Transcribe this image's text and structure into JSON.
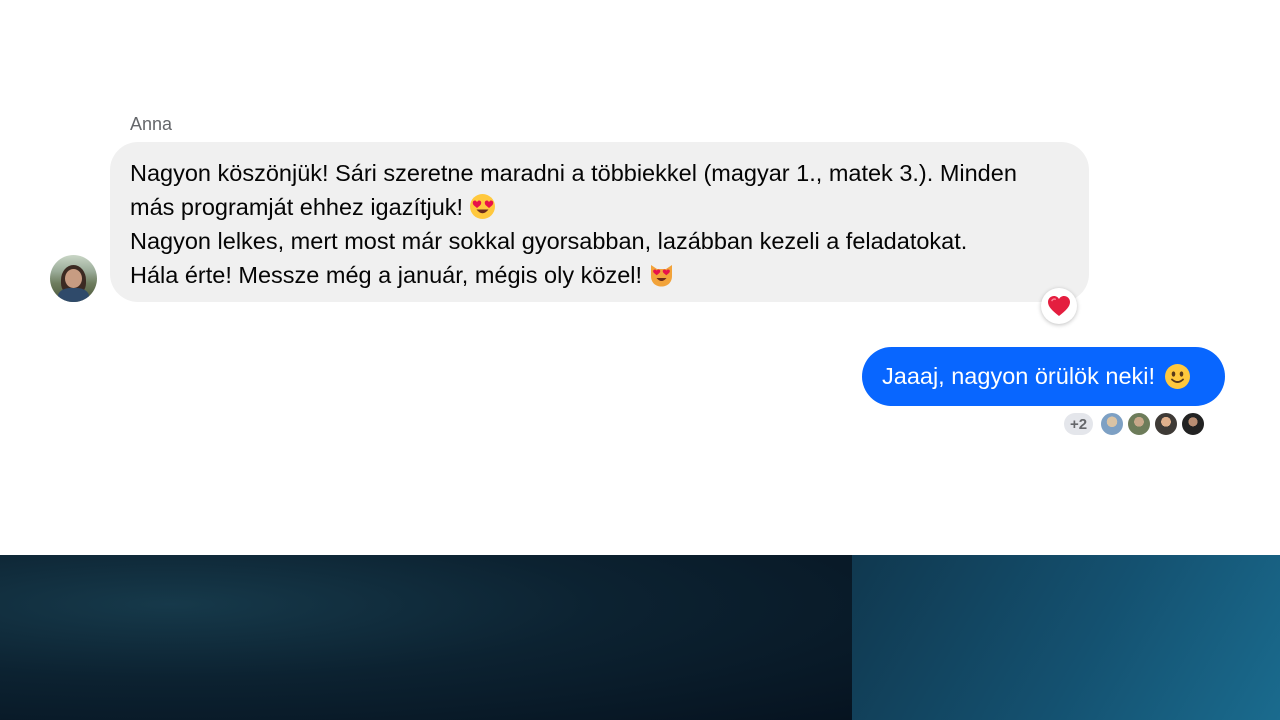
{
  "conversation": {
    "incoming": {
      "sender_name": "Anna",
      "lines": [
        "Nagyon köszönjük! Sári szeretne maradni a többiekkel (magyar 1., matek 3.). Minden",
        "más programját ehhez igazítjuk!",
        "Nagyon lelkes, mert most már sokkal gyorsabban, lazábban kezeli a feladatokat.",
        "Hála érte! Messze még a január, mégis oly közel!"
      ],
      "emojis": [
        "heart-eyes-emoji",
        "heart-eyes-cat-emoji"
      ],
      "reaction": "heart-reaction"
    },
    "outgoing": {
      "text": "Jaaaj, nagyon örülök neki!",
      "emoji": "smiling-face-emoji",
      "seen_extra_count": "+2",
      "seen_avatars": 4
    }
  },
  "colors": {
    "incoming_bubble": "#f0f0f0",
    "outgoing_bubble": "#0866ff",
    "sender_name": "#65676b",
    "heart": "#e41e3f"
  }
}
